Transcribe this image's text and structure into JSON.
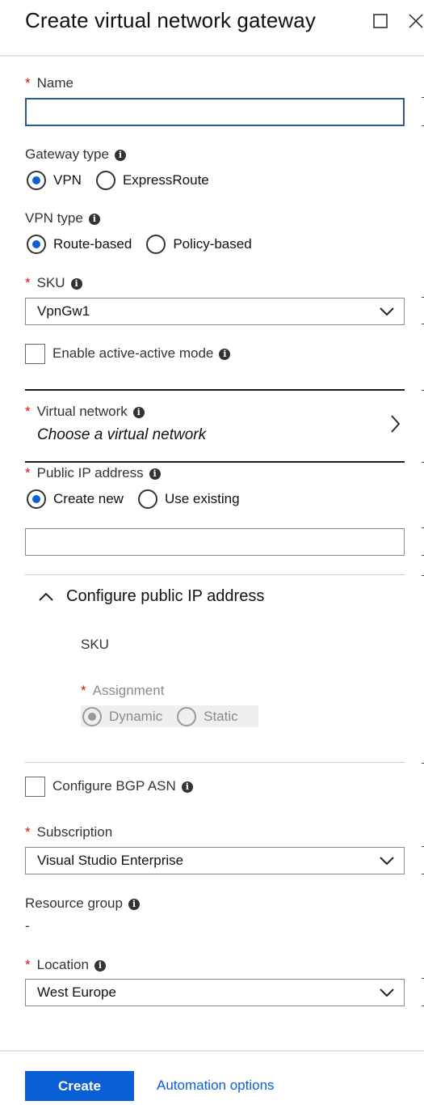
{
  "header": {
    "title": "Create virtual network gateway"
  },
  "fields": {
    "name": {
      "label": "Name",
      "value": ""
    },
    "gateway_type": {
      "label": "Gateway type",
      "options": [
        "VPN",
        "ExpressRoute"
      ],
      "selected": "VPN"
    },
    "vpn_type": {
      "label": "VPN type",
      "options": [
        "Route-based",
        "Policy-based"
      ],
      "selected": "Route-based"
    },
    "sku": {
      "label": "SKU",
      "value": "VpnGw1"
    },
    "active_active": {
      "label": "Enable active-active mode",
      "checked": false
    },
    "virtual_network": {
      "label": "Virtual network",
      "value": "Choose a virtual network"
    },
    "public_ip": {
      "label": "Public IP address",
      "options": [
        "Create new",
        "Use existing"
      ],
      "selected": "Create new",
      "value": ""
    },
    "configure_public_ip": {
      "title": "Configure public IP address",
      "sku_label": "SKU",
      "assignment_label": "Assignment",
      "assignment_options": [
        "Dynamic",
        "Static"
      ],
      "assignment_selected": "Dynamic"
    },
    "bgp": {
      "label": "Configure BGP ASN",
      "checked": false
    },
    "subscription": {
      "label": "Subscription",
      "value": "Visual Studio Enterprise"
    },
    "resource_group": {
      "label": "Resource group",
      "value": "-"
    },
    "location": {
      "label": "Location",
      "value": "West Europe"
    }
  },
  "footer": {
    "create_label": "Create",
    "automation_label": "Automation options"
  },
  "required_marker": "*",
  "info_glyph": "i",
  "colors": {
    "accent": "#0b5fd6",
    "required": "#dd1111"
  }
}
